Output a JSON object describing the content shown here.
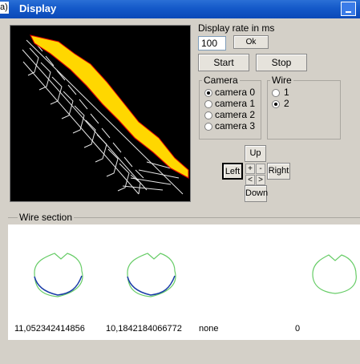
{
  "title_prefix": "a)",
  "window": {
    "title": "Display"
  },
  "display_rate": {
    "label": "Display rate in ms",
    "value": "100",
    "ok_label": "Ok"
  },
  "controls": {
    "start_label": "Start",
    "stop_label": "Stop"
  },
  "camera": {
    "label": "Camera",
    "options": [
      "camera 0",
      "camera 1",
      "camera 2",
      "camera 3"
    ],
    "selected": "camera 0"
  },
  "wire": {
    "label": "Wire",
    "options": [
      "1",
      "2"
    ],
    "selected": "2"
  },
  "navigation": {
    "up": "Up",
    "down": "Down",
    "left": "Left",
    "right": "Right",
    "plus": "+",
    "minus": "-",
    "lt": "<",
    "gt": ">"
  },
  "wire_section": {
    "label": "Wire section",
    "values": [
      "11,052342414856",
      "10,1842184066772",
      "none",
      "0"
    ]
  },
  "colors": {
    "profile": "#66cc66",
    "measured": "#1a3ca8",
    "fill": "#ffd700",
    "edge": "#e00000"
  }
}
